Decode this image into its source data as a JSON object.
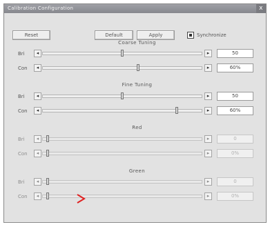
{
  "window": {
    "title": "Calibration Configuration",
    "close_glyph": "x"
  },
  "toolbar": {
    "reset_label": "Reset",
    "default_label": "Default",
    "apply_label": "Apply",
    "sync_checkbox_label": "Synchronize",
    "sync_checked": true
  },
  "sections": [
    {
      "title": "Coarse Tuning",
      "rows": [
        {
          "label": "Bri",
          "value": "50",
          "position": 0.5,
          "enabled": true
        },
        {
          "label": "Con",
          "value": "60%",
          "position": 0.6,
          "enabled": true
        }
      ]
    },
    {
      "title": "Fine Tuning",
      "rows": [
        {
          "label": "Bri",
          "value": "50",
          "position": 0.5,
          "enabled": true
        },
        {
          "label": "Con",
          "value": "60%",
          "position": 0.85,
          "enabled": true
        }
      ]
    },
    {
      "title": "Red",
      "rows": [
        {
          "label": "Bri",
          "value": "0",
          "position": 0.02,
          "enabled": false
        },
        {
          "label": "Con",
          "value": "0%",
          "position": 0.02,
          "enabled": false
        }
      ]
    },
    {
      "title": "Green",
      "rows": [
        {
          "label": "Bri",
          "value": "0",
          "position": 0.02,
          "enabled": false
        },
        {
          "label": "Con",
          "value": "0%",
          "position": 0.02,
          "enabled": false
        }
      ]
    }
  ],
  "glyphs": {
    "left_arrow": "◂",
    "right_arrow": "▸"
  },
  "colors": {
    "cursor": "#e02020"
  },
  "icons": {
    "cursor": "pointer-arrow-icon"
  }
}
